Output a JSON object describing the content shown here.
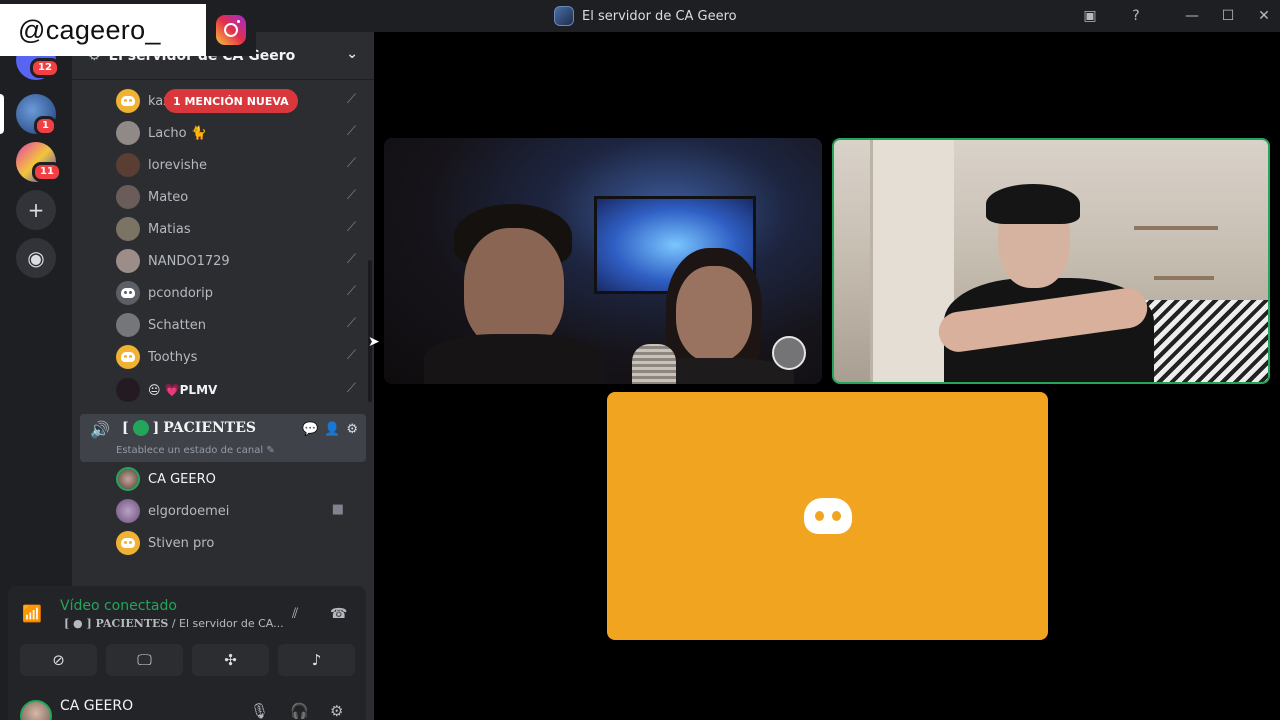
{
  "watermark": {
    "handle": "@cageero_",
    "icon": "instagram-icon"
  },
  "window": {
    "title": "El servidor de CA Geero"
  },
  "rail": {
    "badges": {
      "home": "12",
      "server1": "1",
      "server2": "11"
    }
  },
  "guild": {
    "name": "El servidor de CA Geero"
  },
  "mention_pill": "1 MENCIÓN NUEVA",
  "members": [
    {
      "name": "kaz",
      "avatar": "discord-default"
    },
    {
      "name": "Lacho 🐈",
      "avatar": "photo"
    },
    {
      "name": "lorevishe",
      "avatar": "photo"
    },
    {
      "name": "Mateo",
      "avatar": "photo"
    },
    {
      "name": "Matias",
      "avatar": "photo"
    },
    {
      "name": "NANDO1729",
      "avatar": "photo"
    },
    {
      "name": "pcondorip",
      "avatar": "discord-default"
    },
    {
      "name": "Schatten",
      "avatar": "photo"
    },
    {
      "name": "Toothys",
      "avatar": "discord-default"
    },
    {
      "name": "😐 💗PLMV",
      "avatar": "photo"
    }
  ],
  "voice_channel": {
    "name": "PACIENTES",
    "bracket_open": "[",
    "bracket_close": "]",
    "status_placeholder": "Establece un estado de canal ✎",
    "members": [
      {
        "name": "CA GEERO"
      },
      {
        "name": "elgordoemei"
      },
      {
        "name": "Stiven pro"
      }
    ]
  },
  "voice_panel": {
    "status": "Vídeo conectado",
    "channel_prefix": "[ ● ] PACIENTES",
    "channel_suffix": " / El servidor de CA..."
  },
  "user": {
    "name": "CA GEERO"
  },
  "colors": {
    "accent_green": "#23a55a",
    "mention_red": "#da373c",
    "tile_orange": "#f0a41f"
  }
}
